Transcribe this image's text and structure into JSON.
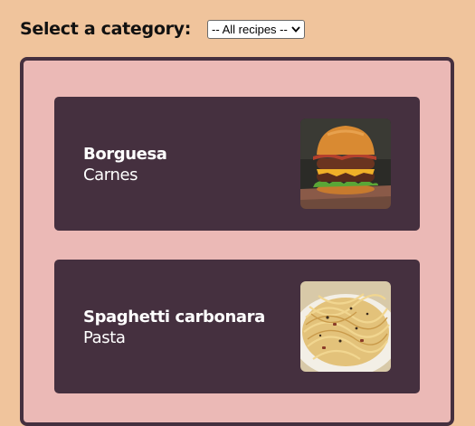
{
  "filter": {
    "label": "Select a category:",
    "selected": "-- All recipes --"
  },
  "recipes": [
    {
      "name": "Borguesa",
      "category": "Carnes",
      "image": "burger-photo"
    },
    {
      "name": "Spaghetti carbonara",
      "category": "Pasta",
      "image": "pasta-photo"
    }
  ],
  "colors": {
    "page_bg": "#f0c49c",
    "panel_bg": "#ebb9b6",
    "card_bg": "#45303f",
    "card_text": "#ffffff"
  }
}
